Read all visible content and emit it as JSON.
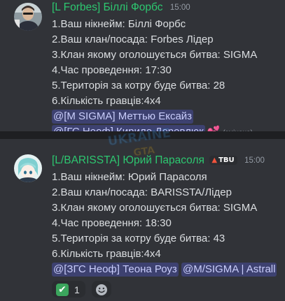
{
  "messages": [
    {
      "author": "[L Forbes] Біллі Форбс",
      "time": "15:00",
      "lines": [
        "1.Ваш нікнейм: Біллі Форбс",
        "2.Ваш клан/посада: Forbes Лідер",
        "3.Клан якому оголошується битва: SIGMA",
        "4.Час проведення: 17:30",
        "5.Територія за котру буде битва: 28",
        "6.Кількість гравців:4x4"
      ],
      "mentions": [
        "@[M SIGMA] Меттью Ексайз",
        "@[ГС Неоф] Кирило Деревлюк"
      ],
      "edited_label": "(змінено)"
    },
    {
      "author": "[L/BARISSTA] Юрий Парасоля",
      "tag": "TBU",
      "time": "15:00",
      "lines": [
        "1.Ваш нікнейм: Юрий Парасоля",
        "2.Ваш клан/посада: BARISSTA/Лідер",
        "3.Клан якому оголошується битва: SIGMA",
        "4.Час проведення: 18:30",
        "5.Територія за котру буде битва:  43",
        "6.Кількість гравців:4x4"
      ],
      "mentions": [
        "@[ЗГС Неоф] Теона Роуз",
        "@M/SIGMA | Astrall"
      ],
      "reactions": [
        {
          "icon": "check-mark-icon",
          "count": "1"
        }
      ]
    }
  ],
  "watermark": {
    "line1": "UKRAINE",
    "line2": "GTA"
  },
  "colors": {
    "background": "#313338",
    "author": "#2dc770",
    "mention_bg": "rgba(88,101,242,0.3)",
    "mention_text": "#c9cdfb",
    "check": "#3ba55d"
  }
}
